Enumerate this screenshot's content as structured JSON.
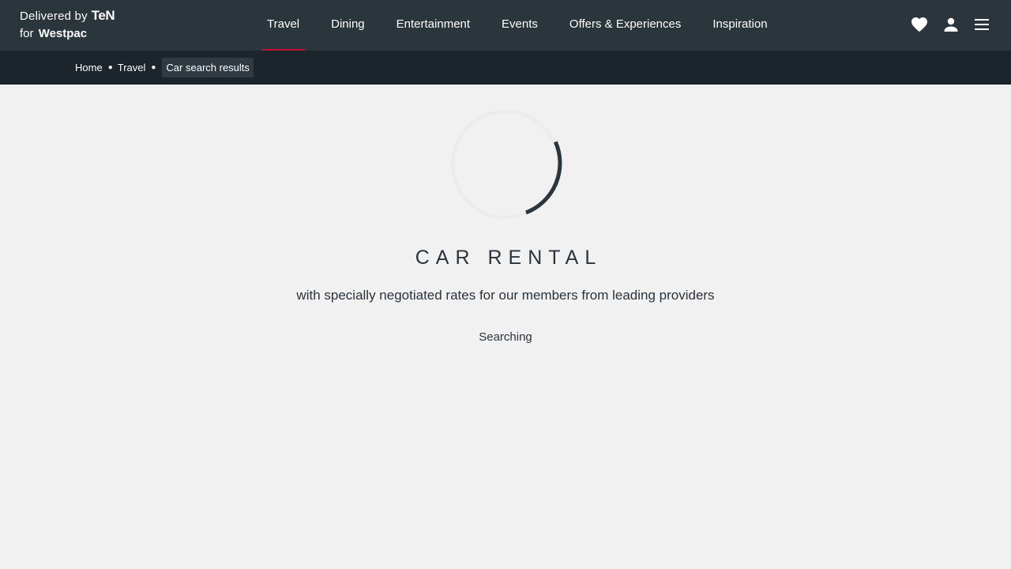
{
  "header": {
    "logo_delivered_by": "Delivered by",
    "logo_brand": "TeN",
    "logo_for": "for",
    "logo_bank": "Westpac",
    "nav": [
      {
        "label": "Travel",
        "active": true
      },
      {
        "label": "Dining",
        "active": false
      },
      {
        "label": "Entertainment",
        "active": false
      },
      {
        "label": "Events",
        "active": false
      },
      {
        "label": "Offers & Experiences",
        "active": false
      },
      {
        "label": "Inspiration",
        "active": false
      }
    ],
    "icons": [
      "heart-icon",
      "user-icon",
      "menu-icon"
    ]
  },
  "breadcrumb": {
    "items": [
      "Home",
      "Travel"
    ],
    "current": "Car search results"
  },
  "main": {
    "title": "CAR RENTAL",
    "subtitle": "with specially negotiated rates for our members from leading providers",
    "status": "Searching"
  },
  "colors": {
    "topbar": "#2b353c",
    "breadcrumb_bar": "#1d252c",
    "background": "#f1f1f1",
    "accent": "#c8102e",
    "spinner": "#2b353c"
  }
}
